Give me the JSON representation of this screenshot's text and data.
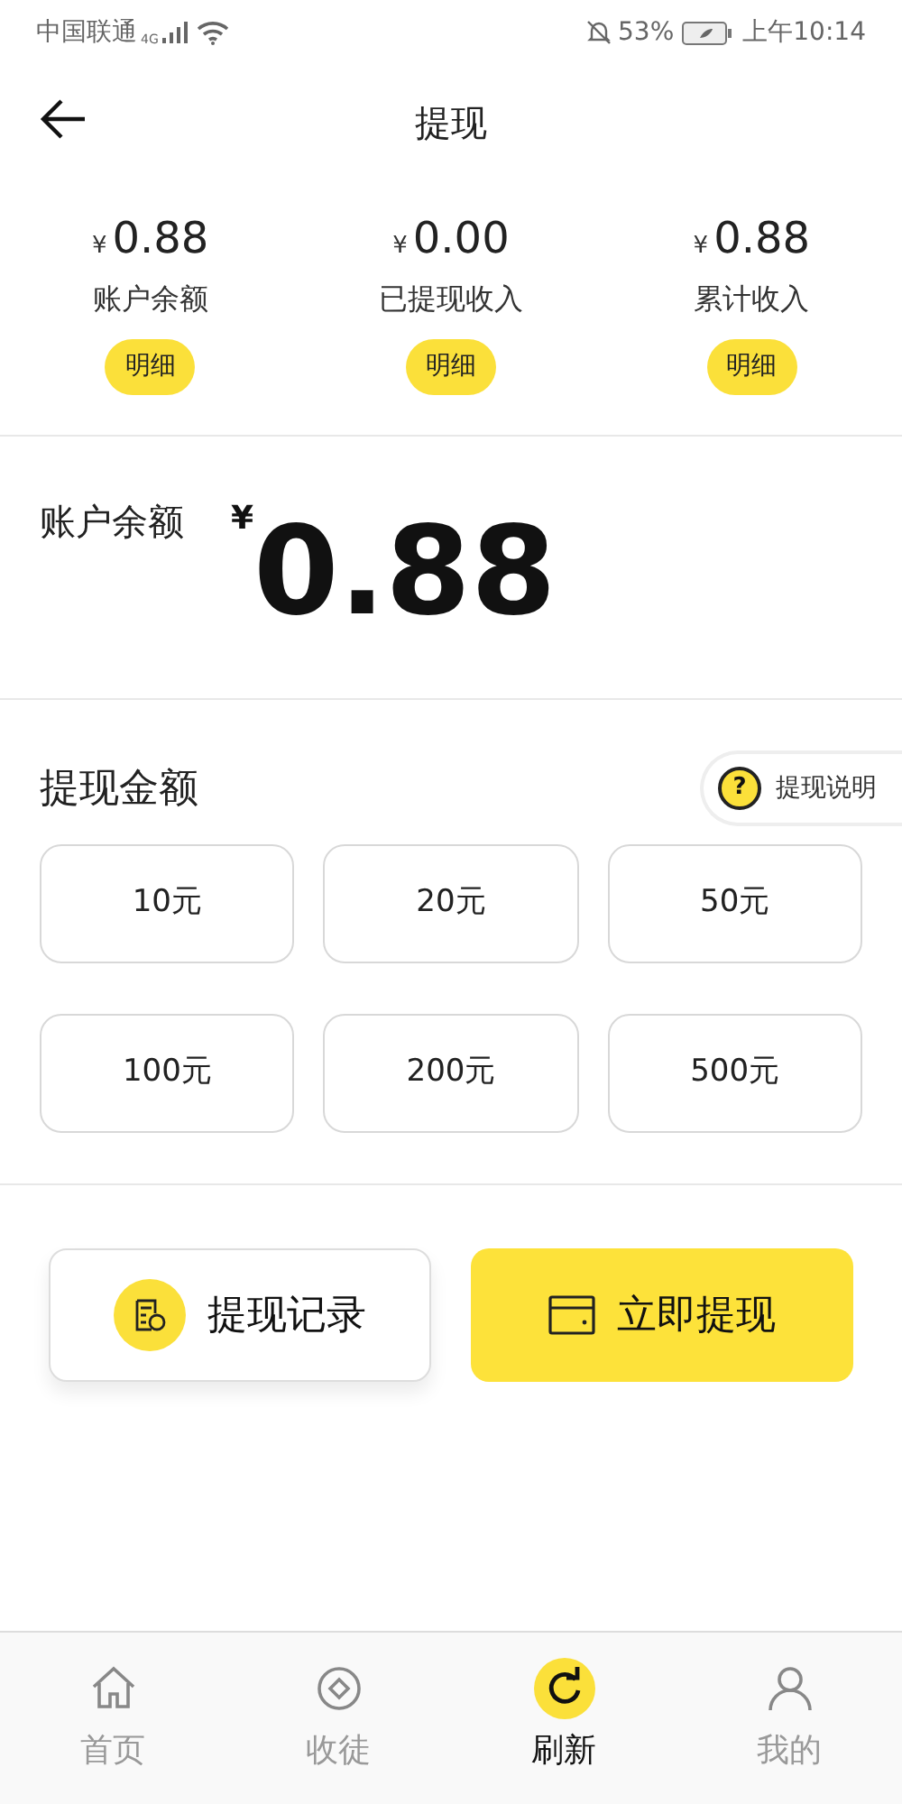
{
  "status_bar": {
    "carrier": "中国联通",
    "network": "4G",
    "battery": "53%",
    "time": "上午10:14"
  },
  "header": {
    "title": "提现"
  },
  "stats": [
    {
      "currency": "¥",
      "amount": "0.88",
      "label": "账户余额",
      "button": "明细"
    },
    {
      "currency": "¥",
      "amount": "0.00",
      "label": "已提现收入",
      "button": "明细"
    },
    {
      "currency": "¥",
      "amount": "0.88",
      "label": "累计收入",
      "button": "明细"
    }
  ],
  "balance": {
    "label": "账户余额",
    "currency": "¥",
    "amount": "0.88"
  },
  "withdraw": {
    "title": "提现金额",
    "help_icon": "?",
    "help": "提现说明",
    "options": [
      "10元",
      "20元",
      "50元",
      "100元",
      "200元",
      "500元"
    ]
  },
  "actions": [
    {
      "kind": "record",
      "label": "提现记录"
    },
    {
      "kind": "withdraw",
      "label": "立即提现"
    }
  ],
  "tab_bar": [
    {
      "kind": "home",
      "label": "首页",
      "selected": false
    },
    {
      "kind": "coin",
      "label": "收徒",
      "selected": false
    },
    {
      "kind": "refresh",
      "label": "刷新",
      "selected": true
    },
    {
      "kind": "person",
      "label": "我的",
      "selected": false
    }
  ]
}
